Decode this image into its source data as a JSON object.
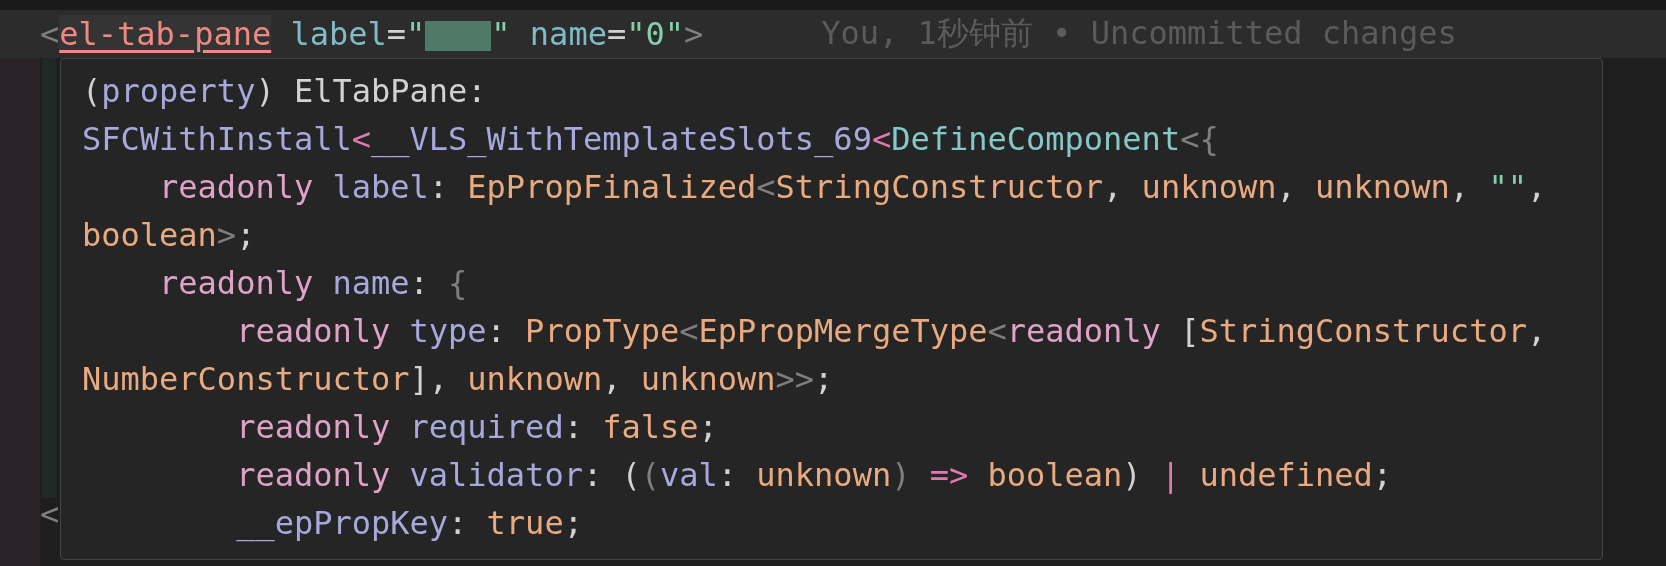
{
  "editor": {
    "current_line": {
      "tokens": [
        {
          "text": "<",
          "kind": "punct"
        },
        {
          "text": "el-tab-pane",
          "kind": "tag"
        },
        {
          "text": " label",
          "kind": "attr"
        },
        {
          "text": "=",
          "kind": "plain"
        },
        {
          "text": "\"",
          "kind": "string"
        },
        {
          "kind": "redacted"
        },
        {
          "text": "\"",
          "kind": "string"
        },
        {
          "text": " name",
          "kind": "attr"
        },
        {
          "text": "=",
          "kind": "plain"
        },
        {
          "text": "\"0\"",
          "kind": "string"
        },
        {
          "text": ">",
          "kind": "punct"
        }
      ],
      "blame": "You, 1秒钟前 • Uncommitted changes"
    },
    "covered_line": {
      "tokens": [
        {
          "text": "<",
          "kind": "punct"
        }
      ]
    }
  },
  "tooltip": {
    "lines": [
      [
        {
          "text": "(",
          "kind": "plain"
        },
        {
          "text": "property",
          "kind": "property"
        },
        {
          "text": ") ElTabPane:",
          "kind": "plain"
        }
      ],
      [
        {
          "text": "SFCWithInstall",
          "kind": "property"
        },
        {
          "text": "<",
          "kind": "operator"
        },
        {
          "text": "__VLS_WithTemplateSlots_69",
          "kind": "property"
        },
        {
          "text": "<",
          "kind": "operator"
        },
        {
          "text": "DefineComponent",
          "kind": "func"
        },
        {
          "text": "<{",
          "kind": "punct"
        }
      ],
      [
        {
          "text": "    readonly ",
          "kind": "keyword"
        },
        {
          "text": "label",
          "kind": "property"
        },
        {
          "text": ": ",
          "kind": "plain"
        },
        {
          "text": "EpPropFinalized",
          "kind": "type"
        },
        {
          "text": "<",
          "kind": "punct"
        },
        {
          "text": "StringConstructor",
          "kind": "type"
        },
        {
          "text": ", ",
          "kind": "plain"
        },
        {
          "text": "unknown",
          "kind": "type"
        },
        {
          "text": ", ",
          "kind": "plain"
        },
        {
          "text": "unknown",
          "kind": "type"
        },
        {
          "text": ", ",
          "kind": "plain"
        },
        {
          "text": "\"\"",
          "kind": "string"
        },
        {
          "text": ",",
          "kind": "plain"
        }
      ],
      [
        {
          "text": "boolean",
          "kind": "type"
        },
        {
          "text": ">",
          "kind": "punct"
        },
        {
          "text": ";",
          "kind": "plain"
        }
      ],
      [
        {
          "text": "    readonly ",
          "kind": "keyword"
        },
        {
          "text": "name",
          "kind": "property"
        },
        {
          "text": ": ",
          "kind": "plain"
        },
        {
          "text": "{",
          "kind": "punct"
        }
      ],
      [
        {
          "text": "        readonly ",
          "kind": "keyword"
        },
        {
          "text": "type",
          "kind": "property"
        },
        {
          "text": ": ",
          "kind": "plain"
        },
        {
          "text": "PropType",
          "kind": "type"
        },
        {
          "text": "<",
          "kind": "punct"
        },
        {
          "text": "EpPropMergeType",
          "kind": "type"
        },
        {
          "text": "<",
          "kind": "punct"
        },
        {
          "text": "readonly",
          "kind": "keyword"
        },
        {
          "text": " [",
          "kind": "plain"
        },
        {
          "text": "StringConstructor",
          "kind": "type"
        },
        {
          "text": ",",
          "kind": "plain"
        }
      ],
      [
        {
          "text": "NumberConstructor",
          "kind": "type"
        },
        {
          "text": "], ",
          "kind": "plain"
        },
        {
          "text": "unknown",
          "kind": "type"
        },
        {
          "text": ", ",
          "kind": "plain"
        },
        {
          "text": "unknown",
          "kind": "type"
        },
        {
          "text": ">>",
          "kind": "punct"
        },
        {
          "text": ";",
          "kind": "plain"
        }
      ],
      [
        {
          "text": "        readonly ",
          "kind": "keyword"
        },
        {
          "text": "required",
          "kind": "property"
        },
        {
          "text": ": ",
          "kind": "plain"
        },
        {
          "text": "false",
          "kind": "type"
        },
        {
          "text": ";",
          "kind": "plain"
        }
      ],
      [
        {
          "text": "        readonly ",
          "kind": "keyword"
        },
        {
          "text": "validator",
          "kind": "property"
        },
        {
          "text": ": (",
          "kind": "plain"
        },
        {
          "text": "(",
          "kind": "punct"
        },
        {
          "text": "val",
          "kind": "property"
        },
        {
          "text": ": ",
          "kind": "plain"
        },
        {
          "text": "unknown",
          "kind": "type"
        },
        {
          "text": ")",
          "kind": "punct"
        },
        {
          "text": " => ",
          "kind": "operator"
        },
        {
          "text": "boolean",
          "kind": "type"
        },
        {
          "text": ") ",
          "kind": "plain"
        },
        {
          "text": "| ",
          "kind": "operator"
        },
        {
          "text": "undefined",
          "kind": "type"
        },
        {
          "text": ";",
          "kind": "plain"
        }
      ],
      [
        {
          "text": "        __epPropKey",
          "kind": "property"
        },
        {
          "text": ": ",
          "kind": "plain"
        },
        {
          "text": "true",
          "kind": "type"
        },
        {
          "text": ";",
          "kind": "plain"
        }
      ]
    ]
  }
}
